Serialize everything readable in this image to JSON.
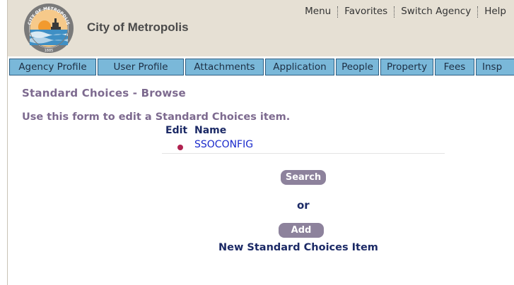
{
  "header": {
    "city_name": "City of Metropolis",
    "logo_text_top": "CITY OF METROPOLIS",
    "logo_text_bottom": "1885"
  },
  "top_nav": {
    "menu": "Menu",
    "favorites": "Favorites",
    "switch_agency": "Switch Agency",
    "help": "Help"
  },
  "tabs": [
    "Agency Profile",
    "User Profile",
    "Attachments",
    "Application",
    "People",
    "Property",
    "Fees",
    "Insp"
  ],
  "main": {
    "title": "Standard Choices - Browse",
    "instructions": "Use this form to edit a Standard Choices item.",
    "col_edit": "Edit",
    "col_name": "Name",
    "rows": [
      "SSOCONFIG"
    ],
    "search_label": "Search",
    "or_label": "or",
    "add_label": "Add",
    "new_item_label": "New Standard Choices Item"
  },
  "colors": {
    "header_bg": "#e6e0d4",
    "tab_bg": "#7ab8d9",
    "title_color": "#7d6a8f",
    "button_bg": "#8d829c",
    "link_color": "#1a2acc",
    "bullet_color": "#b02250"
  }
}
